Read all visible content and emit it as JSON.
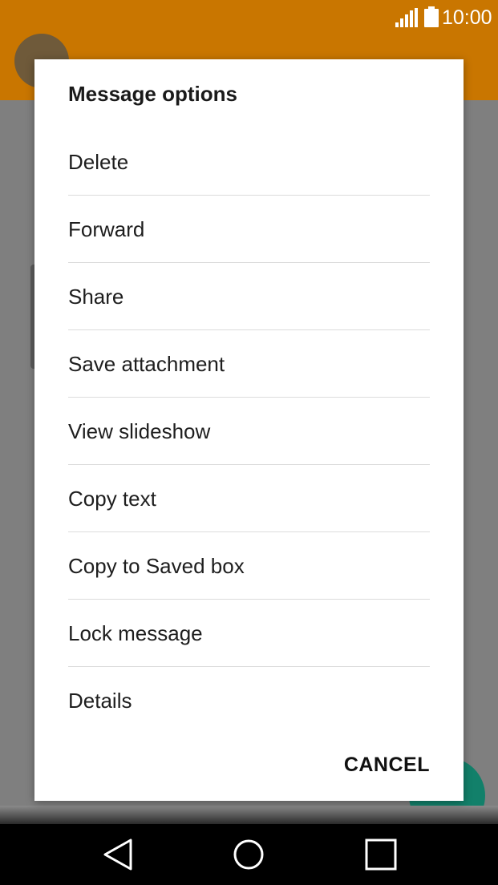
{
  "status_bar": {
    "time": "10:00",
    "icons": [
      "signal-icon",
      "battery-icon"
    ]
  },
  "dialog": {
    "title": "Message options",
    "options": [
      {
        "label": "Delete"
      },
      {
        "label": "Forward"
      },
      {
        "label": "Share"
      },
      {
        "label": "Save attachment"
      },
      {
        "label": "View slideshow"
      },
      {
        "label": "Copy text"
      },
      {
        "label": "Copy to Saved box"
      },
      {
        "label": "Lock message"
      },
      {
        "label": "Details"
      }
    ],
    "cancel_label": "CANCEL"
  },
  "nav_bar": {
    "icons": [
      "back-icon",
      "home-icon",
      "recents-icon"
    ]
  },
  "colors": {
    "app_bar": "#c97600",
    "dialog_bg": "#ffffff",
    "fab": "#12806a"
  }
}
